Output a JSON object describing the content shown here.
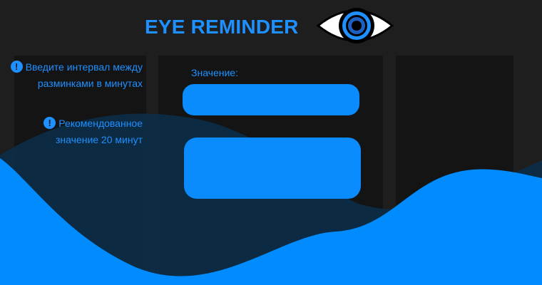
{
  "app": {
    "title": "EYE REMINDER",
    "logo_icon": "eye-icon"
  },
  "sidebar": {
    "hints": [
      {
        "icon": "info-icon",
        "text": "Введите интервал между разминками в минутах"
      },
      {
        "icon": "info-icon",
        "text": "Рекомендованное значение 20 минут"
      }
    ]
  },
  "form": {
    "label": "Значение:",
    "input_value": "",
    "button_label": ""
  },
  "colors": {
    "accent": "#1e90ff",
    "input_fill": "#0a8cff",
    "background": "#1e1e1e",
    "panel": "#141414",
    "wave_front": "#008cff",
    "wave_back": "#0a2e4a"
  }
}
